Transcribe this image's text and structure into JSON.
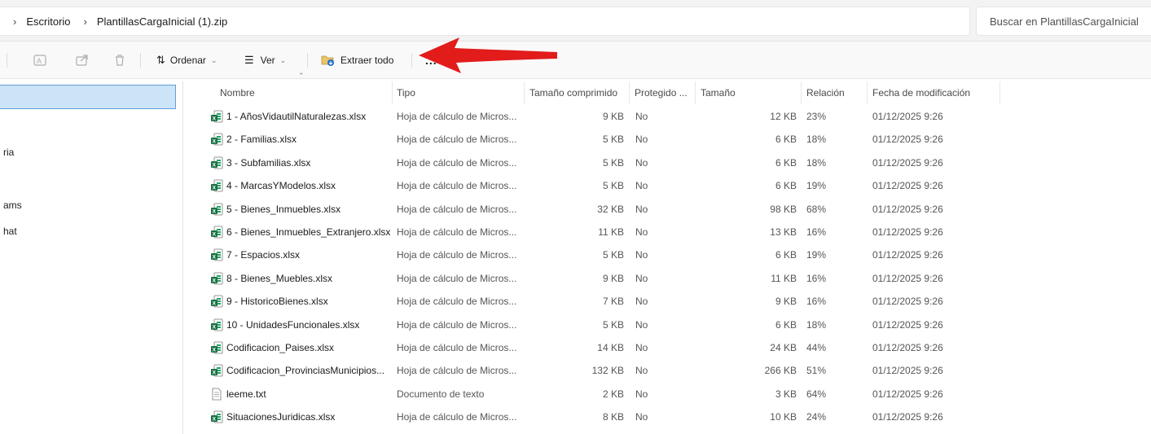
{
  "breadcrumb": [
    "Escritorio",
    "PlantillasCargaInicial (1).zip"
  ],
  "search_placeholder": "Buscar en PlantillasCargaInicial",
  "toolbar": {
    "sort_label": "Ordenar",
    "view_label": "Ver",
    "extract_label": "Extraer todo",
    "more_label": "..."
  },
  "sidebar_items": [
    "ria",
    "ams",
    "hat"
  ],
  "columns": [
    "Nombre",
    "Tipo",
    "Tamaño comprimido",
    "Protegido ...",
    "Tamaño",
    "Relación",
    "Fecha de modificación"
  ],
  "files": [
    {
      "name": "1 - AñosVidautilNaturalezas.xlsx",
      "type": "Hoja de cálculo de Micros...",
      "compressed": "9 KB",
      "protected": "No",
      "size": "12 KB",
      "ratio": "23%",
      "date": "01/12/2025 9:26",
      "icon": "excel-file-icon"
    },
    {
      "name": "2 - Familias.xlsx",
      "type": "Hoja de cálculo de Micros...",
      "compressed": "5 KB",
      "protected": "No",
      "size": "6 KB",
      "ratio": "18%",
      "date": "01/12/2025 9:26",
      "icon": "excel-file-icon"
    },
    {
      "name": "3 - Subfamilias.xlsx",
      "type": "Hoja de cálculo de Micros...",
      "compressed": "5 KB",
      "protected": "No",
      "size": "6 KB",
      "ratio": "18%",
      "date": "01/12/2025 9:26",
      "icon": "excel-file-icon"
    },
    {
      "name": "4 - MarcasYModelos.xlsx",
      "type": "Hoja de cálculo de Micros...",
      "compressed": "5 KB",
      "protected": "No",
      "size": "6 KB",
      "ratio": "19%",
      "date": "01/12/2025 9:26",
      "icon": "excel-file-icon"
    },
    {
      "name": "5 - Bienes_Inmuebles.xlsx",
      "type": "Hoja de cálculo de Micros...",
      "compressed": "32 KB",
      "protected": "No",
      "size": "98 KB",
      "ratio": "68%",
      "date": "01/12/2025 9:26",
      "icon": "excel-file-icon"
    },
    {
      "name": "6 - Bienes_Inmuebles_Extranjero.xlsx",
      "type": "Hoja de cálculo de Micros...",
      "compressed": "11 KB",
      "protected": "No",
      "size": "13 KB",
      "ratio": "16%",
      "date": "01/12/2025 9:26",
      "icon": "excel-file-icon"
    },
    {
      "name": "7 - Espacios.xlsx",
      "type": "Hoja de cálculo de Micros...",
      "compressed": "5 KB",
      "protected": "No",
      "size": "6 KB",
      "ratio": "19%",
      "date": "01/12/2025 9:26",
      "icon": "excel-file-icon"
    },
    {
      "name": "8 - Bienes_Muebles.xlsx",
      "type": "Hoja de cálculo de Micros...",
      "compressed": "9 KB",
      "protected": "No",
      "size": "11 KB",
      "ratio": "16%",
      "date": "01/12/2025 9:26",
      "icon": "excel-file-icon"
    },
    {
      "name": "9 - HistoricoBienes.xlsx",
      "type": "Hoja de cálculo de Micros...",
      "compressed": "7 KB",
      "protected": "No",
      "size": "9 KB",
      "ratio": "16%",
      "date": "01/12/2025 9:26",
      "icon": "excel-file-icon"
    },
    {
      "name": "10 - UnidadesFuncionales.xlsx",
      "type": "Hoja de cálculo de Micros...",
      "compressed": "5 KB",
      "protected": "No",
      "size": "6 KB",
      "ratio": "18%",
      "date": "01/12/2025 9:26",
      "icon": "excel-file-icon"
    },
    {
      "name": "Codificacion_Paises.xlsx",
      "type": "Hoja de cálculo de Micros...",
      "compressed": "14 KB",
      "protected": "No",
      "size": "24 KB",
      "ratio": "44%",
      "date": "01/12/2025 9:26",
      "icon": "excel-file-icon"
    },
    {
      "name": "Codificacion_ProvinciasMunicipios...",
      "type": "Hoja de cálculo de Micros...",
      "compressed": "132 KB",
      "protected": "No",
      "size": "266 KB",
      "ratio": "51%",
      "date": "01/12/2025 9:26",
      "icon": "excel-file-icon"
    },
    {
      "name": "leeme.txt",
      "type": "Documento de texto",
      "compressed": "2 KB",
      "protected": "No",
      "size": "3 KB",
      "ratio": "64%",
      "date": "01/12/2025 9:26",
      "icon": "text-file-icon"
    },
    {
      "name": "SituacionesJuridicas.xlsx",
      "type": "Hoja de cálculo de Micros...",
      "compressed": "8 KB",
      "protected": "No",
      "size": "10 KB",
      "ratio": "24%",
      "date": "01/12/2025 9:26",
      "icon": "excel-file-icon"
    }
  ],
  "colors": {
    "selection_bg": "#cce4f7",
    "selection_border": "#5e9fd6",
    "annotation_arrow": "#e21b1b",
    "excel_green": "#1d7044"
  }
}
